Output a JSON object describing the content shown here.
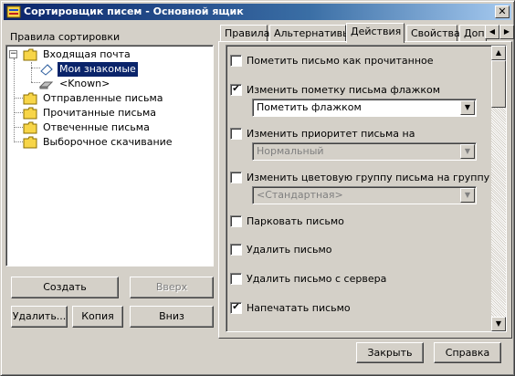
{
  "window": {
    "title": "Сортировщик писем - Основной ящик",
    "close_glyph": "✕"
  },
  "rules": {
    "label": "Правила сортировки",
    "tree": {
      "inbox": "Входящая почта",
      "my_contacts": "Мои знакомые",
      "known": "<Known>",
      "sent": "Отправленные письма",
      "read": "Прочитанные письма",
      "replied": "Отвеченные письма",
      "selective": "Выборочное скачивание"
    },
    "buttons": {
      "create": "Создать",
      "up": "Вверх",
      "delete": "Удалить...",
      "copy": "Копия",
      "down": "Вниз"
    }
  },
  "tabs": {
    "items": [
      "Правила",
      "Альтернативы",
      "Действия",
      "Свойства",
      "Доп"
    ],
    "active": "Действия",
    "scroll_left": "◀",
    "scroll_right": "▶"
  },
  "actions": {
    "mark_read": {
      "label": "Пометить письмо как прочитанное",
      "checked": false
    },
    "change_flag": {
      "label": "Изменить пометку письма флажком",
      "checked": true,
      "value": "Пометить флажком"
    },
    "change_priority": {
      "label": "Изменить приоритет письма на",
      "checked": false,
      "value": "Нормальный"
    },
    "change_color": {
      "label": "Изменить цветовую группу письма на группу",
      "checked": false,
      "value": "<Стандартная>"
    },
    "park": {
      "label": "Парковать письмо",
      "checked": false
    },
    "delete": {
      "label": "Удалить письмо",
      "checked": false
    },
    "delete_server": {
      "label": "Удалить письмо с сервера",
      "checked": false
    },
    "print": {
      "label": "Напечатать письмо",
      "checked": true
    },
    "check_glyph": "✔",
    "dropdown_glyph": "▼",
    "scroll_up": "▲",
    "scroll_down": "▼"
  },
  "footer": {
    "close": "Закрыть",
    "help": "Справка"
  },
  "colors": {
    "titlebar_start": "#0a246a",
    "selection": "#0a246a",
    "face": "#d4d0c8",
    "folder": "#f7d548"
  }
}
